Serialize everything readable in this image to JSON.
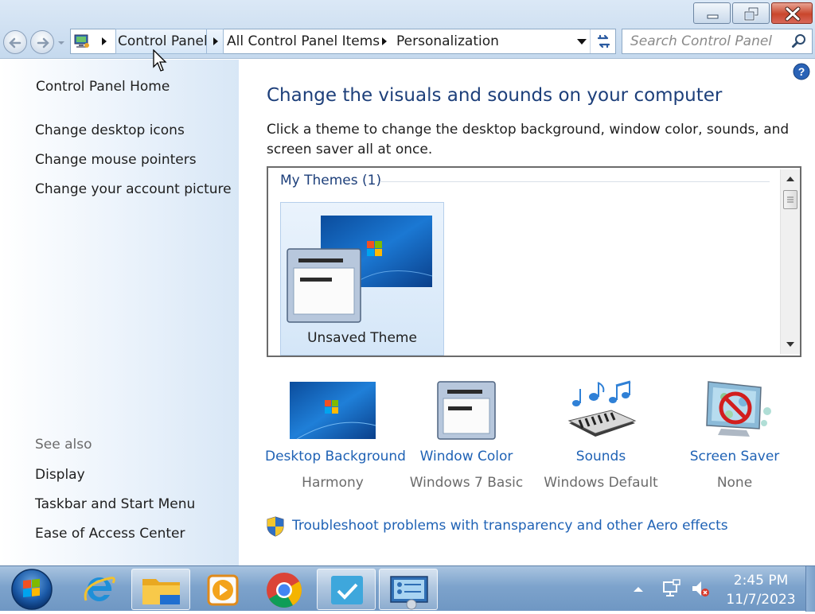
{
  "window": {
    "minimize_icon": "minimize-icon",
    "maximize_icon": "restore-icon",
    "close_icon": "close-icon"
  },
  "address": {
    "crumbs": [
      "Control Panel",
      "All Control Panel Items",
      "Personalization"
    ]
  },
  "search": {
    "placeholder": "Search Control Panel"
  },
  "sidebar": {
    "home": "Control Panel Home",
    "links": [
      "Change desktop icons",
      "Change mouse pointers",
      "Change your account picture"
    ],
    "see_also_heading": "See also",
    "see_also": [
      "Display",
      "Taskbar and Start Menu",
      "Ease of Access Center"
    ]
  },
  "main": {
    "title": "Change the visuals and sounds on your computer",
    "description": "Click a theme to change the desktop background, window color, sounds, and screen saver all at once.",
    "group_label": "My Themes (1)",
    "theme_name": "Unsaved Theme",
    "settings": [
      {
        "label": "Desktop Background",
        "value": "Harmony"
      },
      {
        "label": "Window Color",
        "value": "Windows 7 Basic"
      },
      {
        "label": "Sounds",
        "value": "Windows Default"
      },
      {
        "label": "Screen Saver",
        "value": "None"
      }
    ],
    "troubleshoot": "Troubleshoot problems with transparency and other Aero effects"
  },
  "taskbar": {
    "apps": [
      "internet-explorer",
      "file-explorer",
      "media-player",
      "chrome",
      "task-app",
      "control-panel"
    ],
    "time": "2:45 PM",
    "date": "11/7/2023"
  },
  "colors": {
    "accent": "#1f62b5",
    "title": "#1d3f7a"
  }
}
